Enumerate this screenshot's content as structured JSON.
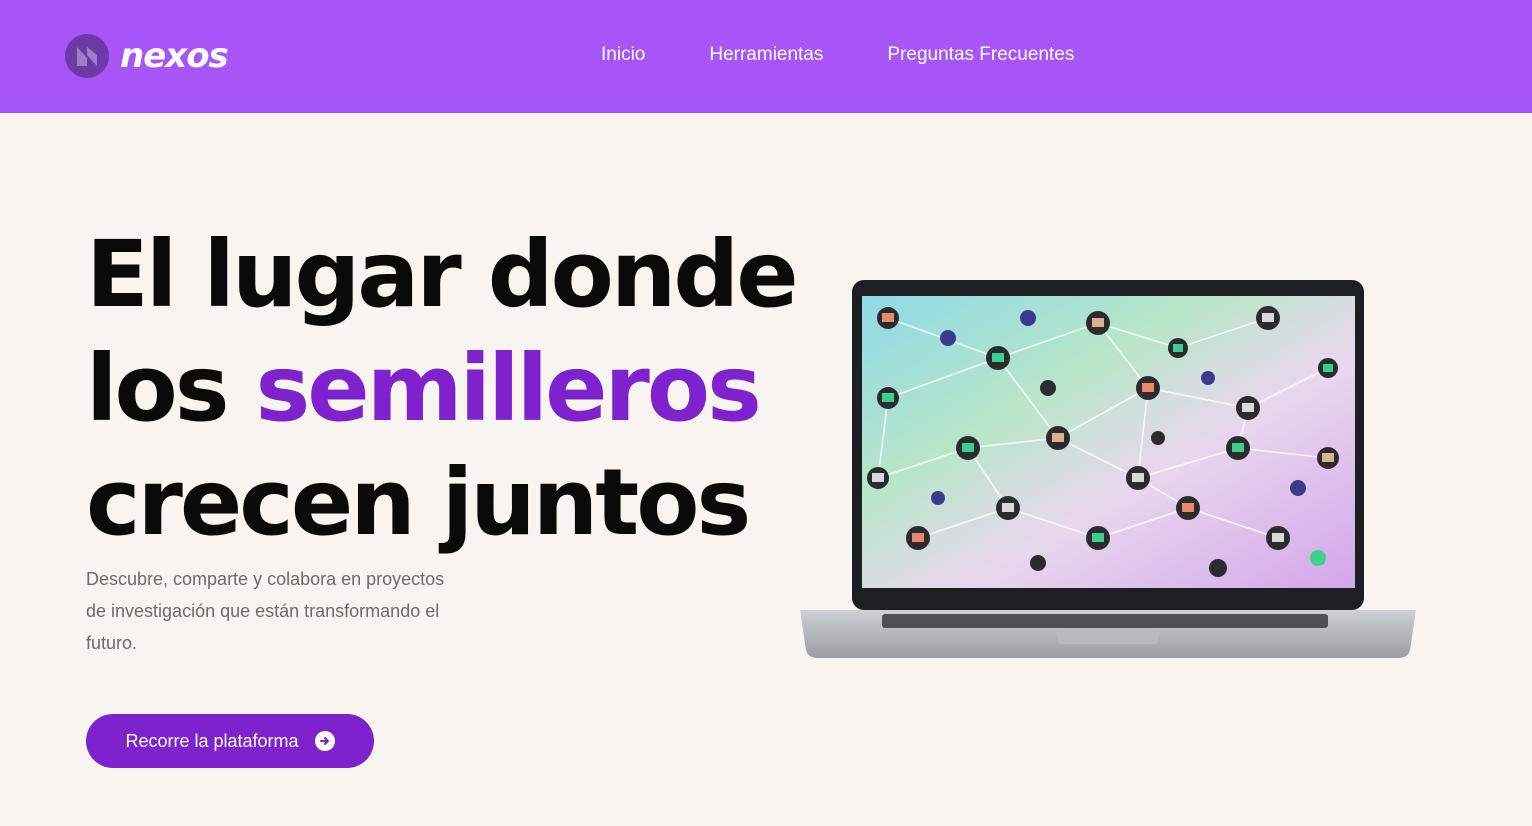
{
  "brand": {
    "name": "nexos",
    "color": "#a855f7",
    "accent": "#7e22ce"
  },
  "nav": {
    "items": [
      {
        "label": "Inicio"
      },
      {
        "label": "Herramientas"
      },
      {
        "label": "Preguntas Frecuentes"
      }
    ]
  },
  "hero": {
    "title_line1": "El lugar donde",
    "title_line2_prefix": "los ",
    "title_line2_accent": "semilleros",
    "title_line3": "crecen juntos",
    "subtitle": "Descubre, comparte y colabora en proyectos de investigación que están transformando el futuro.",
    "cta_label": "Recorre la plataforma",
    "cta_icon": "arrow-right-circle-icon"
  },
  "illustration": {
    "icon": "laptop-network-icon"
  }
}
